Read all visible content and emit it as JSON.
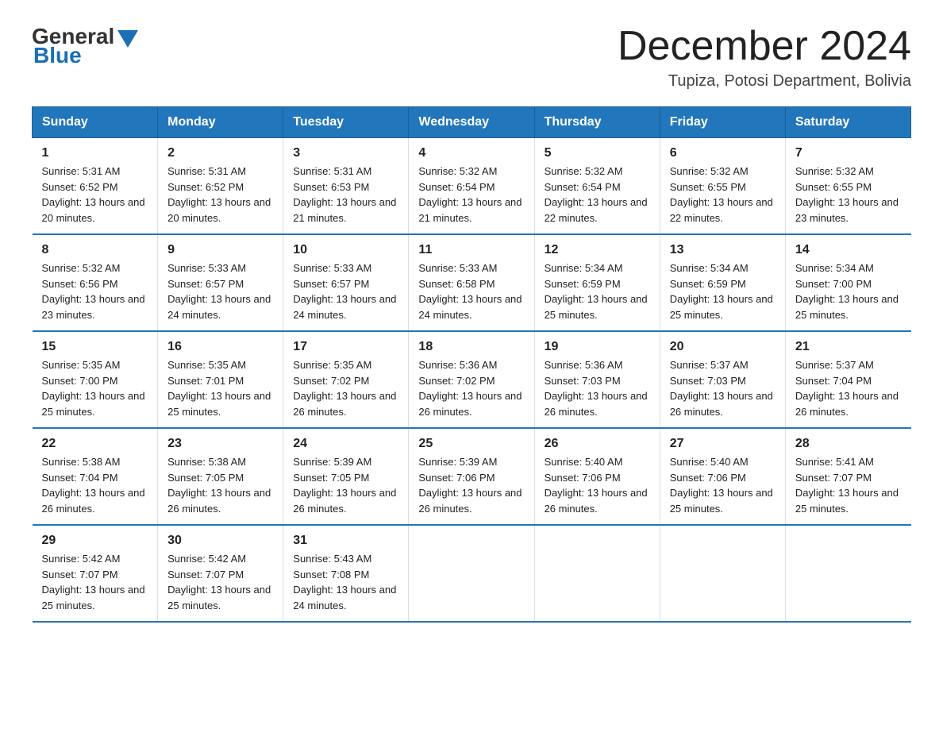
{
  "header": {
    "logo_general": "General",
    "logo_blue": "Blue",
    "title": "December 2024",
    "subtitle": "Tupiza, Potosi Department, Bolivia"
  },
  "days_of_week": [
    "Sunday",
    "Monday",
    "Tuesday",
    "Wednesday",
    "Thursday",
    "Friday",
    "Saturday"
  ],
  "weeks": [
    [
      {
        "day": "1",
        "sunrise": "5:31 AM",
        "sunset": "6:52 PM",
        "daylight": "13 hours and 20 minutes."
      },
      {
        "day": "2",
        "sunrise": "5:31 AM",
        "sunset": "6:52 PM",
        "daylight": "13 hours and 20 minutes."
      },
      {
        "day": "3",
        "sunrise": "5:31 AM",
        "sunset": "6:53 PM",
        "daylight": "13 hours and 21 minutes."
      },
      {
        "day": "4",
        "sunrise": "5:32 AM",
        "sunset": "6:54 PM",
        "daylight": "13 hours and 21 minutes."
      },
      {
        "day": "5",
        "sunrise": "5:32 AM",
        "sunset": "6:54 PM",
        "daylight": "13 hours and 22 minutes."
      },
      {
        "day": "6",
        "sunrise": "5:32 AM",
        "sunset": "6:55 PM",
        "daylight": "13 hours and 22 minutes."
      },
      {
        "day": "7",
        "sunrise": "5:32 AM",
        "sunset": "6:55 PM",
        "daylight": "13 hours and 23 minutes."
      }
    ],
    [
      {
        "day": "8",
        "sunrise": "5:32 AM",
        "sunset": "6:56 PM",
        "daylight": "13 hours and 23 minutes."
      },
      {
        "day": "9",
        "sunrise": "5:33 AM",
        "sunset": "6:57 PM",
        "daylight": "13 hours and 24 minutes."
      },
      {
        "day": "10",
        "sunrise": "5:33 AM",
        "sunset": "6:57 PM",
        "daylight": "13 hours and 24 minutes."
      },
      {
        "day": "11",
        "sunrise": "5:33 AM",
        "sunset": "6:58 PM",
        "daylight": "13 hours and 24 minutes."
      },
      {
        "day": "12",
        "sunrise": "5:34 AM",
        "sunset": "6:59 PM",
        "daylight": "13 hours and 25 minutes."
      },
      {
        "day": "13",
        "sunrise": "5:34 AM",
        "sunset": "6:59 PM",
        "daylight": "13 hours and 25 minutes."
      },
      {
        "day": "14",
        "sunrise": "5:34 AM",
        "sunset": "7:00 PM",
        "daylight": "13 hours and 25 minutes."
      }
    ],
    [
      {
        "day": "15",
        "sunrise": "5:35 AM",
        "sunset": "7:00 PM",
        "daylight": "13 hours and 25 minutes."
      },
      {
        "day": "16",
        "sunrise": "5:35 AM",
        "sunset": "7:01 PM",
        "daylight": "13 hours and 25 minutes."
      },
      {
        "day": "17",
        "sunrise": "5:35 AM",
        "sunset": "7:02 PM",
        "daylight": "13 hours and 26 minutes."
      },
      {
        "day": "18",
        "sunrise": "5:36 AM",
        "sunset": "7:02 PM",
        "daylight": "13 hours and 26 minutes."
      },
      {
        "day": "19",
        "sunrise": "5:36 AM",
        "sunset": "7:03 PM",
        "daylight": "13 hours and 26 minutes."
      },
      {
        "day": "20",
        "sunrise": "5:37 AM",
        "sunset": "7:03 PM",
        "daylight": "13 hours and 26 minutes."
      },
      {
        "day": "21",
        "sunrise": "5:37 AM",
        "sunset": "7:04 PM",
        "daylight": "13 hours and 26 minutes."
      }
    ],
    [
      {
        "day": "22",
        "sunrise": "5:38 AM",
        "sunset": "7:04 PM",
        "daylight": "13 hours and 26 minutes."
      },
      {
        "day": "23",
        "sunrise": "5:38 AM",
        "sunset": "7:05 PM",
        "daylight": "13 hours and 26 minutes."
      },
      {
        "day": "24",
        "sunrise": "5:39 AM",
        "sunset": "7:05 PM",
        "daylight": "13 hours and 26 minutes."
      },
      {
        "day": "25",
        "sunrise": "5:39 AM",
        "sunset": "7:06 PM",
        "daylight": "13 hours and 26 minutes."
      },
      {
        "day": "26",
        "sunrise": "5:40 AM",
        "sunset": "7:06 PM",
        "daylight": "13 hours and 26 minutes."
      },
      {
        "day": "27",
        "sunrise": "5:40 AM",
        "sunset": "7:06 PM",
        "daylight": "13 hours and 25 minutes."
      },
      {
        "day": "28",
        "sunrise": "5:41 AM",
        "sunset": "7:07 PM",
        "daylight": "13 hours and 25 minutes."
      }
    ],
    [
      {
        "day": "29",
        "sunrise": "5:42 AM",
        "sunset": "7:07 PM",
        "daylight": "13 hours and 25 minutes."
      },
      {
        "day": "30",
        "sunrise": "5:42 AM",
        "sunset": "7:07 PM",
        "daylight": "13 hours and 25 minutes."
      },
      {
        "day": "31",
        "sunrise": "5:43 AM",
        "sunset": "7:08 PM",
        "daylight": "13 hours and 24 minutes."
      },
      {
        "day": "",
        "sunrise": "",
        "sunset": "",
        "daylight": ""
      },
      {
        "day": "",
        "sunrise": "",
        "sunset": "",
        "daylight": ""
      },
      {
        "day": "",
        "sunrise": "",
        "sunset": "",
        "daylight": ""
      },
      {
        "day": "",
        "sunrise": "",
        "sunset": "",
        "daylight": ""
      }
    ]
  ],
  "labels": {
    "sunrise": "Sunrise:",
    "sunset": "Sunset:",
    "daylight": "Daylight:"
  }
}
